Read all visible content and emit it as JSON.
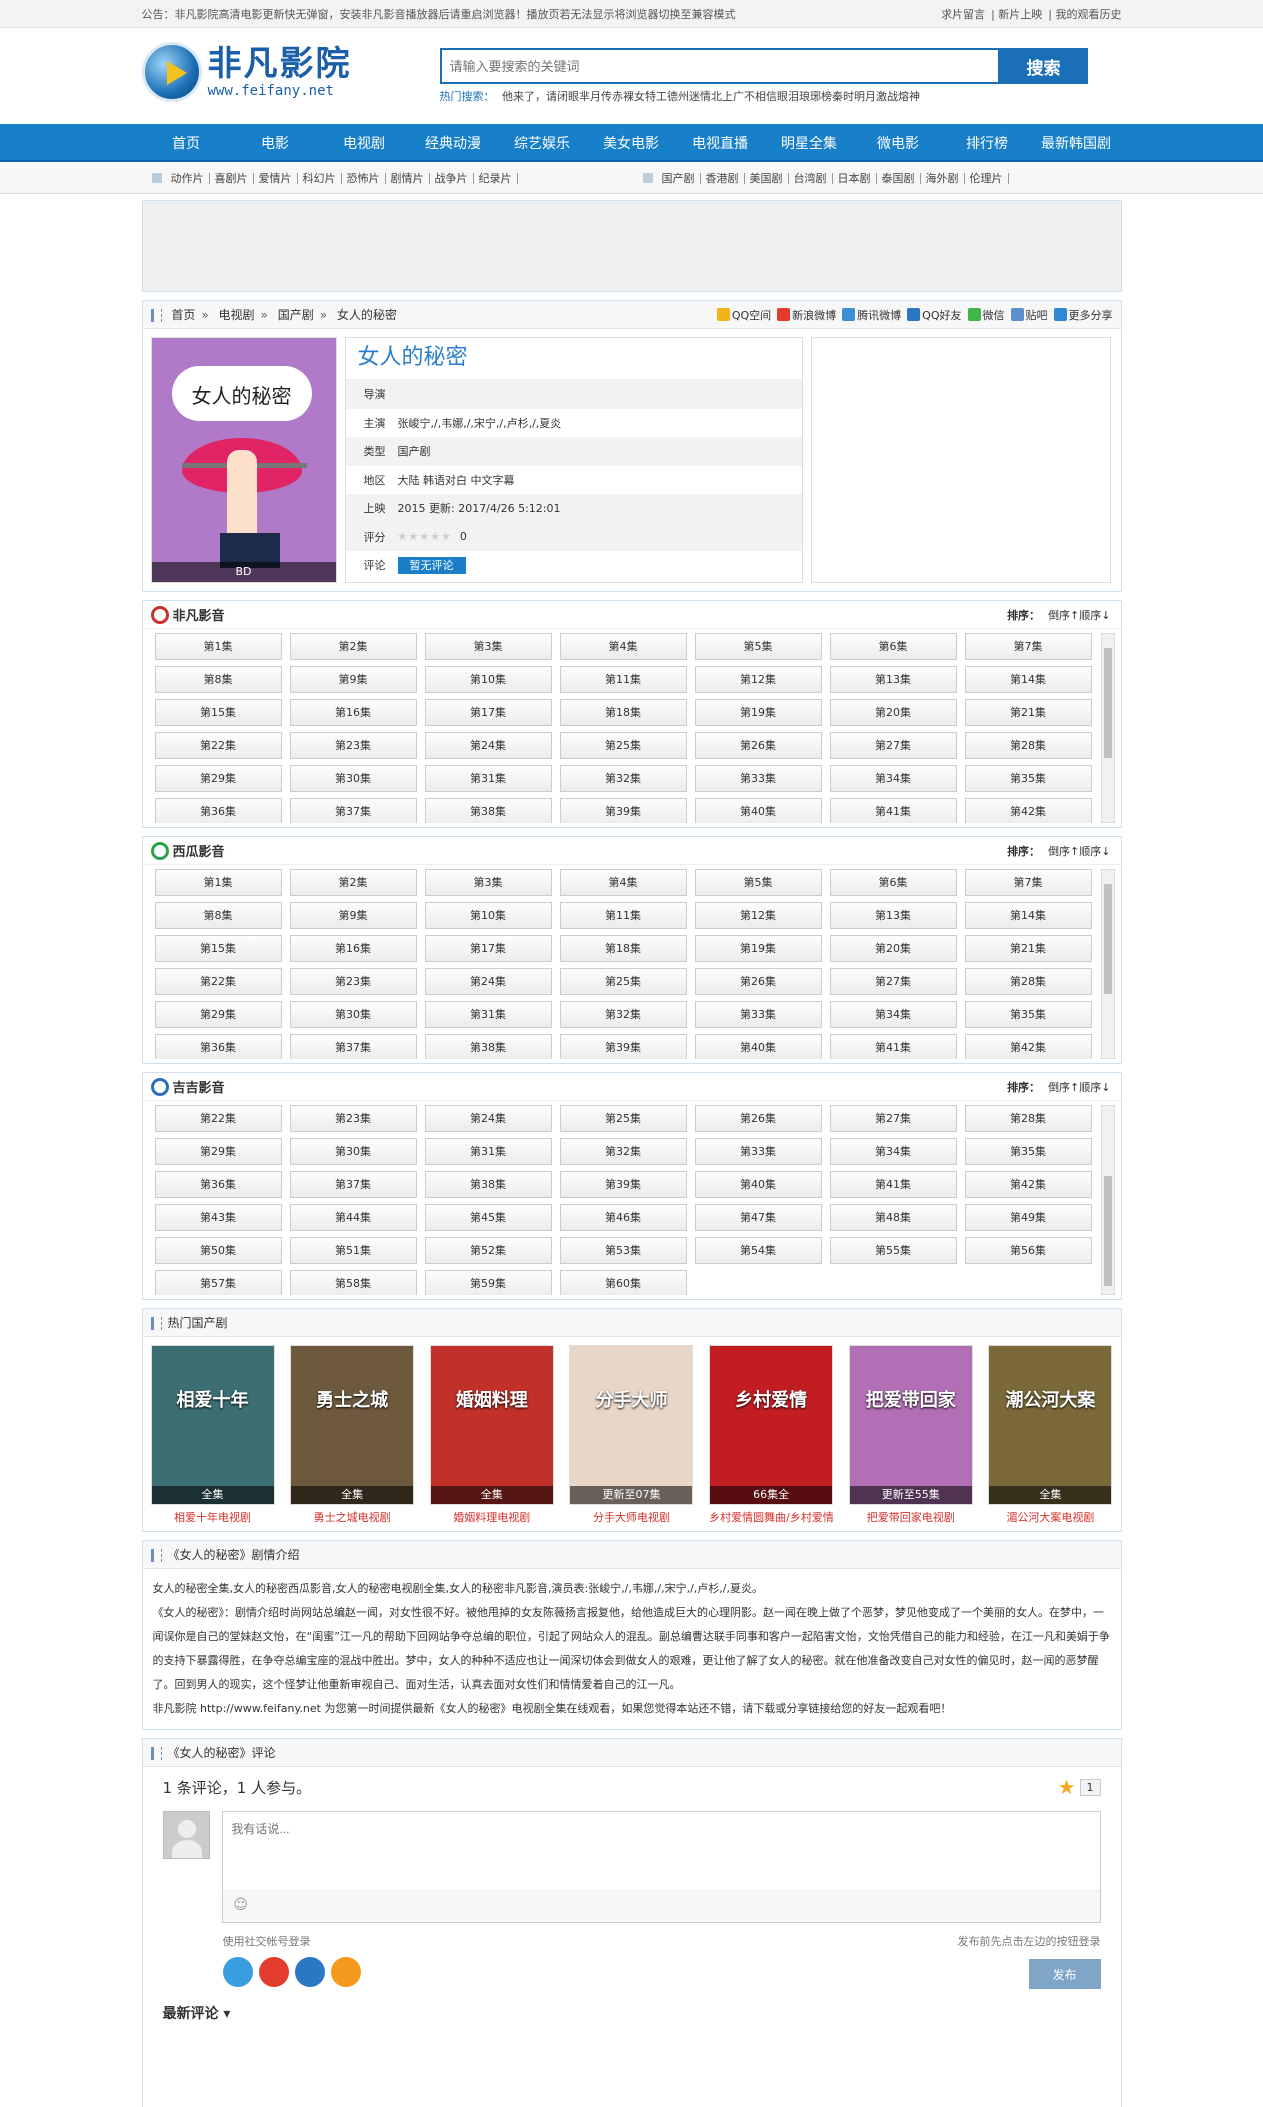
{
  "topbar": {
    "notice": "公告：非凡影院高清电影更新快无弹窗，安装非凡影音播放器后请重启浏览器！播放页若无法显示将浏览器切换至兼容模式",
    "links": [
      "求片留言",
      "新片上映",
      "我的观看历史"
    ]
  },
  "logo": {
    "cn": "非凡影院",
    "en": "www.feifany.net"
  },
  "search": {
    "placeholder": "请输入要搜索的关键词",
    "button": "搜索",
    "hot_label": "热门搜索：",
    "hot": [
      "他来了，请闭眼",
      "芈月传",
      "赤裸女特工",
      "德州迷情",
      "北上广不相信眼泪",
      "琅琊榜",
      "秦时明月",
      "激战",
      "熔神"
    ]
  },
  "nav": [
    "首页",
    "电影",
    "电视剧",
    "经典动漫",
    "综艺娱乐",
    "美女电影",
    "电视直播",
    "明星全集",
    "微电影",
    "排行榜",
    "最新韩国剧"
  ],
  "subnav": {
    "movies": [
      "动作片",
      "喜剧片",
      "爱情片",
      "科幻片",
      "恐怖片",
      "剧情片",
      "战争片",
      "纪录片"
    ],
    "series": [
      "国产剧",
      "香港剧",
      "美国剧",
      "台湾剧",
      "日本剧",
      "泰国剧",
      "海外剧",
      "伦理片"
    ]
  },
  "breadcrumb": [
    "首页",
    "电视剧",
    "国产剧",
    "女人的秘密"
  ],
  "share": [
    "QQ空间",
    "新浪微博",
    "腾讯微博",
    "QQ好友",
    "微信",
    "贴吧",
    "更多分享"
  ],
  "share_colors": [
    "#f3b31a",
    "#e33b2e",
    "#3a8fd6",
    "#2c77c4",
    "#42b84a",
    "#5a8fd0",
    "#2e88d4"
  ],
  "movie": {
    "title": "女人的秘密",
    "poster_text": "女人的秘密",
    "poster_tag": "BD",
    "rows": [
      {
        "k": "导演",
        "v": ""
      },
      {
        "k": "主演",
        "v": "张峻宁,/,韦娜,/,宋宁,/,卢杉,/,夏炎"
      },
      {
        "k": "类型",
        "v": "国产剧"
      },
      {
        "k": "地区",
        "v": "大陆 韩语对白 中文字幕"
      },
      {
        "k": "上映",
        "v": "2015 更新: 2017/4/26 5:12:01"
      }
    ],
    "score_label": "评分",
    "score_stars": "★★★★★",
    "score": "0",
    "review_label": "评论",
    "review_button": "暂无评论"
  },
  "sources": [
    {
      "name": "非凡影音",
      "color": "#c8302c",
      "sort_label": "排序：",
      "sort_desc": "倒序↑",
      "sort_asc": "顺序↓",
      "episodes": [
        "第1集",
        "第2集",
        "第3集",
        "第4集",
        "第5集",
        "第6集",
        "第7集",
        "第8集",
        "第9集",
        "第10集",
        "第11集",
        "第12集",
        "第13集",
        "第14集",
        "第15集",
        "第16集",
        "第17集",
        "第18集",
        "第19集",
        "第20集",
        "第21集",
        "第22集",
        "第23集",
        "第24集",
        "第25集",
        "第26集",
        "第27集",
        "第28集",
        "第29集",
        "第30集",
        "第31集",
        "第32集",
        "第33集",
        "第34集",
        "第35集",
        "第36集",
        "第37集",
        "第38集",
        "第39集",
        "第40集",
        "第41集",
        "第42集"
      ]
    },
    {
      "name": "西瓜影音",
      "color": "#2aa24a",
      "sort_label": "排序：",
      "sort_desc": "倒序↑",
      "sort_asc": "顺序↓",
      "episodes": [
        "第1集",
        "第2集",
        "第3集",
        "第4集",
        "第5集",
        "第6集",
        "第7集",
        "第8集",
        "第9集",
        "第10集",
        "第11集",
        "第12集",
        "第13集",
        "第14集",
        "第15集",
        "第16集",
        "第17集",
        "第18集",
        "第19集",
        "第20集",
        "第21集",
        "第22集",
        "第23集",
        "第24集",
        "第25集",
        "第26集",
        "第27集",
        "第28集",
        "第29集",
        "第30集",
        "第31集",
        "第32集",
        "第33集",
        "第34集",
        "第35集",
        "第36集",
        "第37集",
        "第38集",
        "第39集",
        "第40集",
        "第41集",
        "第42集"
      ]
    },
    {
      "name": "吉吉影音",
      "color": "#2c6fb8",
      "sort_label": "排序：",
      "sort_desc": "倒序↑",
      "sort_asc": "顺序↓",
      "episodes": [
        "第22集",
        "第23集",
        "第24集",
        "第25集",
        "第26集",
        "第27集",
        "第28集",
        "第29集",
        "第30集",
        "第31集",
        "第32集",
        "第33集",
        "第34集",
        "第35集",
        "第36集",
        "第37集",
        "第38集",
        "第39集",
        "第40集",
        "第41集",
        "第42集",
        "第43集",
        "第44集",
        "第45集",
        "第46集",
        "第47集",
        "第48集",
        "第49集",
        "第50集",
        "第51集",
        "第52集",
        "第53集",
        "第54集",
        "第55集",
        "第56集",
        "第57集",
        "第58集",
        "第59集",
        "第60集"
      ]
    }
  ],
  "hot_title": "热门国产剧",
  "hot_items": [
    {
      "title": "相爱十年",
      "tag": "全集",
      "caption": "相爱十年电视剧",
      "color": "#3c6e74"
    },
    {
      "title": "勇士之城",
      "tag": "全集",
      "caption": "勇士之城电视剧",
      "color": "#6d5a3e"
    },
    {
      "title": "婚姻料理",
      "tag": "全集",
      "caption": "婚姻料理电视剧",
      "color": "#c2302a"
    },
    {
      "title": "分手大师",
      "tag": "更新至07集",
      "caption": "分手大师电视剧",
      "color": "#e8d6c8"
    },
    {
      "title": "乡村爱情",
      "tag": "66集全",
      "caption": "乡村爱情圆舞曲/乡村爱情",
      "color": "#c21d23"
    },
    {
      "title": "把爱带回家",
      "tag": "更新至55集",
      "caption": "把爱带回家电视剧",
      "color": "#b26fb6"
    },
    {
      "title": "潮公河大案",
      "tag": "全集",
      "caption": "湄公河大案电视剧",
      "color": "#7a6a3a"
    }
  ],
  "intro": {
    "title": "《女人的秘密》剧情介绍",
    "p1": "女人的秘密全集,女人的秘密西瓜影音,女人的秘密电视剧全集,女人的秘密非凡影音,演员表:张峻宁,/,韦娜,/,宋宁,/,卢杉,/,夏炎。",
    "p2": "《女人的秘密》：剧情介绍时尚网站总编赵一闻，对女性很不好。被他甩掉的女友陈薇扬言报复他，给他造成巨大的心理阴影。赵一闻在晚上做了个恶梦，梦见他变成了一个美丽的女人。在梦中，一闻误你是自己的堂妹赵文怡，在“闺蜜”江一凡的帮助下回网站争夺总编的职位，引起了网站众人的混乱。副总编曹达联手同事和客户一起陷害文怡，文怡凭借自己的能力和经验，在江一凡和美娟于争的支持下暴露得胜，在争夺总编宝座的混战中胜出。梦中，女人的种种不适应也让一闻深切体会到做女人的艰难，更让他了解了女人的秘密。就在他准备改变自己对女性的偏见时，赵一闻的恶梦醒了。回到男人的现实，这个怪梦让他重新审视自己、面对生活，认真去面对女性们和情情爱着自己的江一凡。",
    "p3": "非凡影院 http://www.feifany.net 为您第一时间提供最新《女人的秘密》电视剧全集在线观看，如果您觉得本站还不错，请下载或分享链接给您的好友一起观看吧！"
  },
  "comments": {
    "title": "《女人的秘密》评论",
    "count_text": "1 条评论，1 人参与。",
    "star_count": "1",
    "placeholder": "我有话说...",
    "emoji": "☺",
    "social_label": "使用社交帐号登录",
    "social_colors": [
      "#3a9de0",
      "#e33b2e",
      "#2c77c4",
      "#f59a1c"
    ],
    "hint": "发布前先点击左边的按钮登录",
    "publish": "发布",
    "latest": "最新评论 ▾"
  }
}
